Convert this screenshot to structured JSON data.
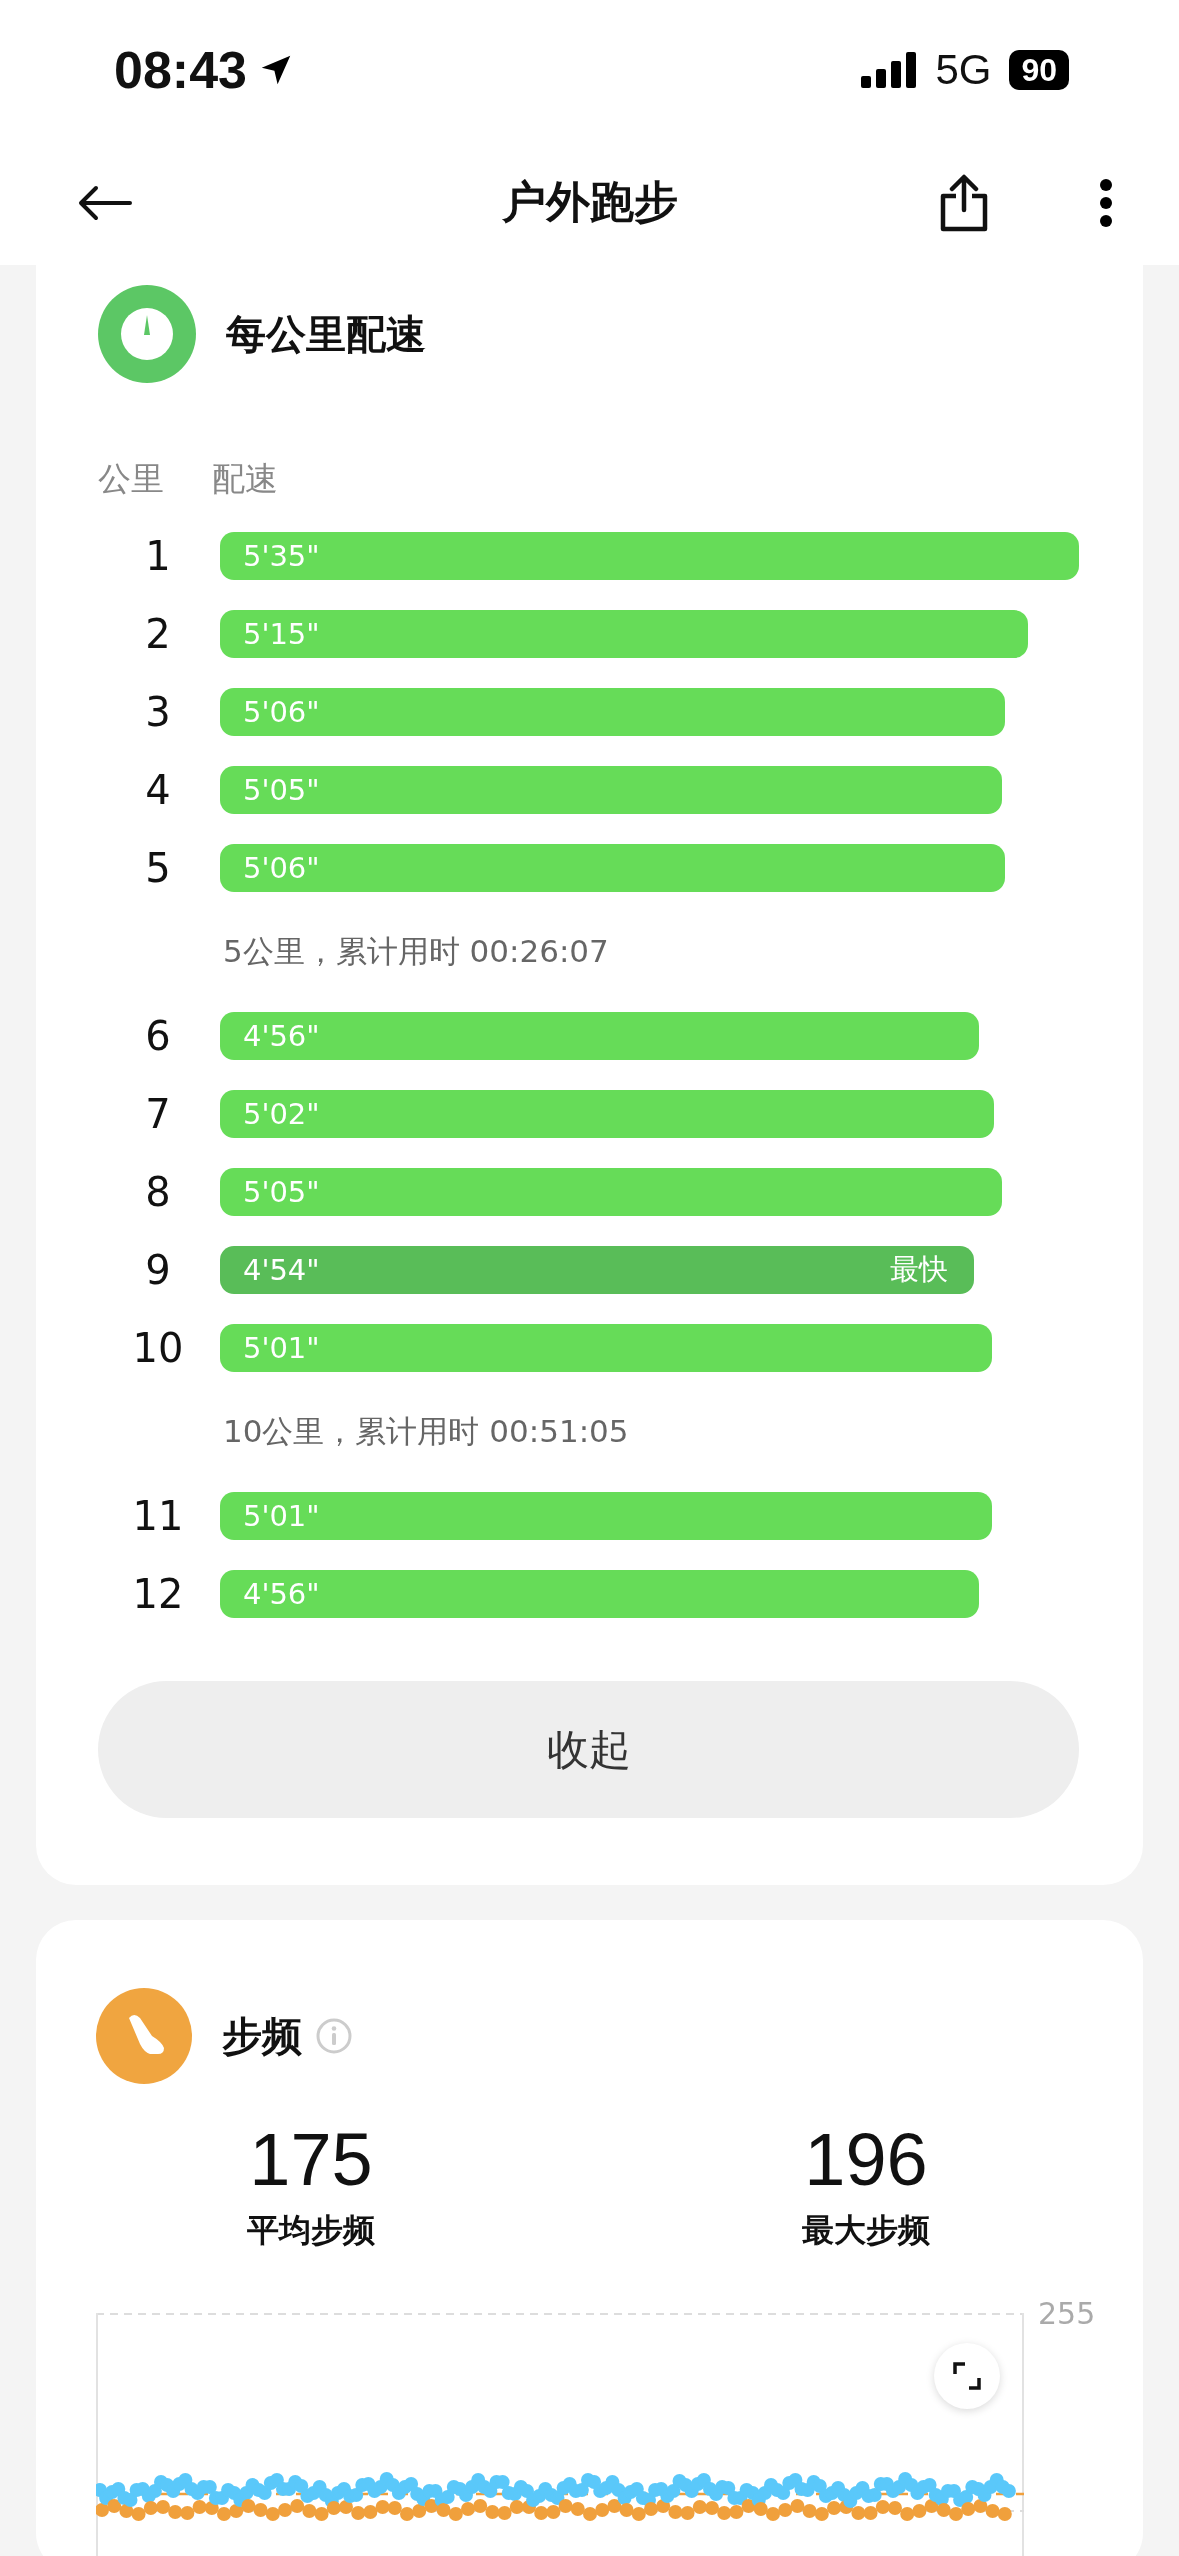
{
  "status_bar": {
    "time": "08:43",
    "network": "5G",
    "battery": "90"
  },
  "nav": {
    "title": "户外跑步"
  },
  "pace_card": {
    "title": "每公里配速",
    "columns": [
      "公里",
      "配速"
    ],
    "rows": [
      {
        "kind": "split",
        "km": "1",
        "pace": "5'35\"",
        "fastest": false
      },
      {
        "kind": "split",
        "km": "2",
        "pace": "5'15\"",
        "fastest": false
      },
      {
        "kind": "split",
        "km": "3",
        "pace": "5'06\"",
        "fastest": false
      },
      {
        "kind": "split",
        "km": "4",
        "pace": "5'05\"",
        "fastest": false
      },
      {
        "kind": "split",
        "km": "5",
        "pace": "5'06\"",
        "fastest": false
      },
      {
        "kind": "summary",
        "text": "5公里，累计用时 00:26:07"
      },
      {
        "kind": "split",
        "km": "6",
        "pace": "4'56\"",
        "fastest": false
      },
      {
        "kind": "split",
        "km": "7",
        "pace": "5'02\"",
        "fastest": false
      },
      {
        "kind": "split",
        "km": "8",
        "pace": "5'05\"",
        "fastest": false
      },
      {
        "kind": "split",
        "km": "9",
        "pace": "4'54\"",
        "fastest": true,
        "badge": "最快"
      },
      {
        "kind": "split",
        "km": "10",
        "pace": "5'01\"",
        "fastest": false
      },
      {
        "kind": "summary",
        "text": "10公里，累计用时 00:51:05"
      },
      {
        "kind": "split",
        "km": "11",
        "pace": "5'01\"",
        "fastest": false
      },
      {
        "kind": "split",
        "km": "12",
        "pace": "4'56\"",
        "fastest": false
      }
    ],
    "collapse_button": "收起"
  },
  "cadence_card": {
    "title": "步频",
    "stats": [
      {
        "value": "175",
        "label": "平均步频"
      },
      {
        "value": "196",
        "label": "最大步频"
      }
    ],
    "chart": {
      "axis_label": "255"
    }
  }
}
